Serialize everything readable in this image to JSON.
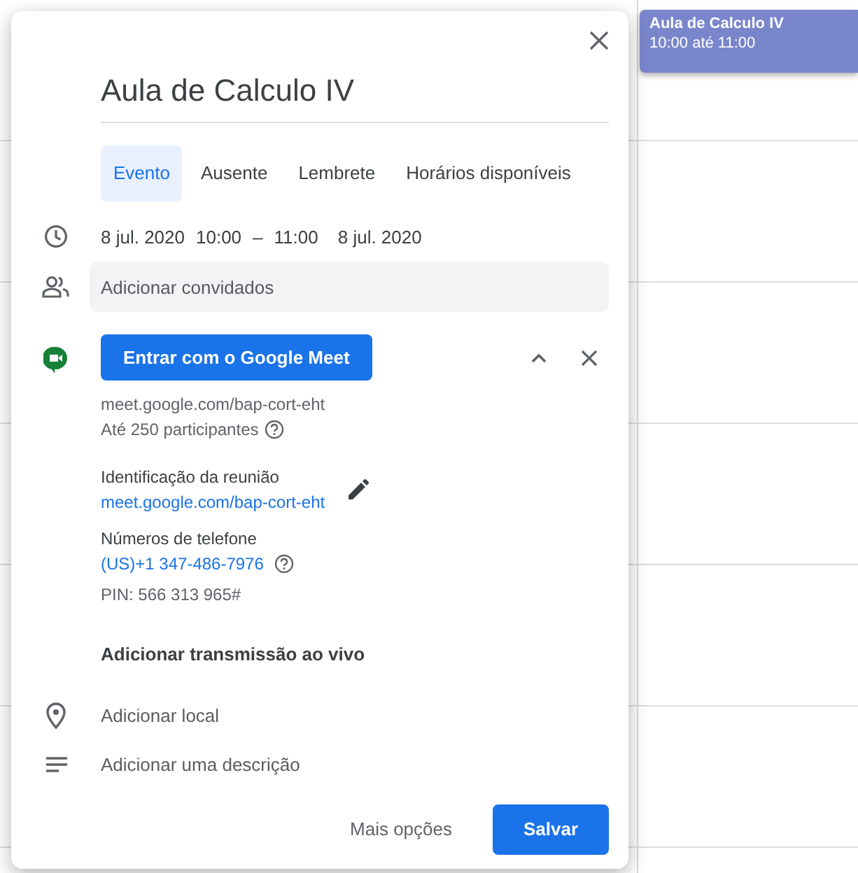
{
  "calendar_event": {
    "title": "Aula de Calculo IV",
    "time": "10:00 até 11:00"
  },
  "dialog": {
    "title": "Aula de Calculo IV",
    "tabs": [
      {
        "label": "Evento",
        "selected": true
      },
      {
        "label": "Ausente",
        "selected": false
      },
      {
        "label": "Lembrete",
        "selected": false
      },
      {
        "label": "Horários disponíveis",
        "selected": false
      }
    ],
    "datetime": {
      "start_date": "8 jul. 2020",
      "start_time": "10:00",
      "separator": "–",
      "end_time": "11:00",
      "end_date": "8 jul. 2020"
    },
    "guests": {
      "placeholder": "Adicionar convidados"
    },
    "meet": {
      "button": "Entrar com o Google Meet",
      "link": "meet.google.com/bap-cort-eht",
      "participants": "Até 250 participantes",
      "id_label": "Identificação da reunião",
      "id_link": "meet.google.com/bap-cort-eht",
      "phone_label": "Números de telefone",
      "phone": "(US)+1 347-486-7976",
      "pin": "PIN: 566 313 965#"
    },
    "live_stream": "Adicionar transmissão ao vivo",
    "location": {
      "placeholder": "Adicionar local"
    },
    "description": {
      "placeholder": "Adicionar uma descrição"
    },
    "buttons": {
      "more": "Mais opções",
      "save": "Salvar"
    }
  }
}
